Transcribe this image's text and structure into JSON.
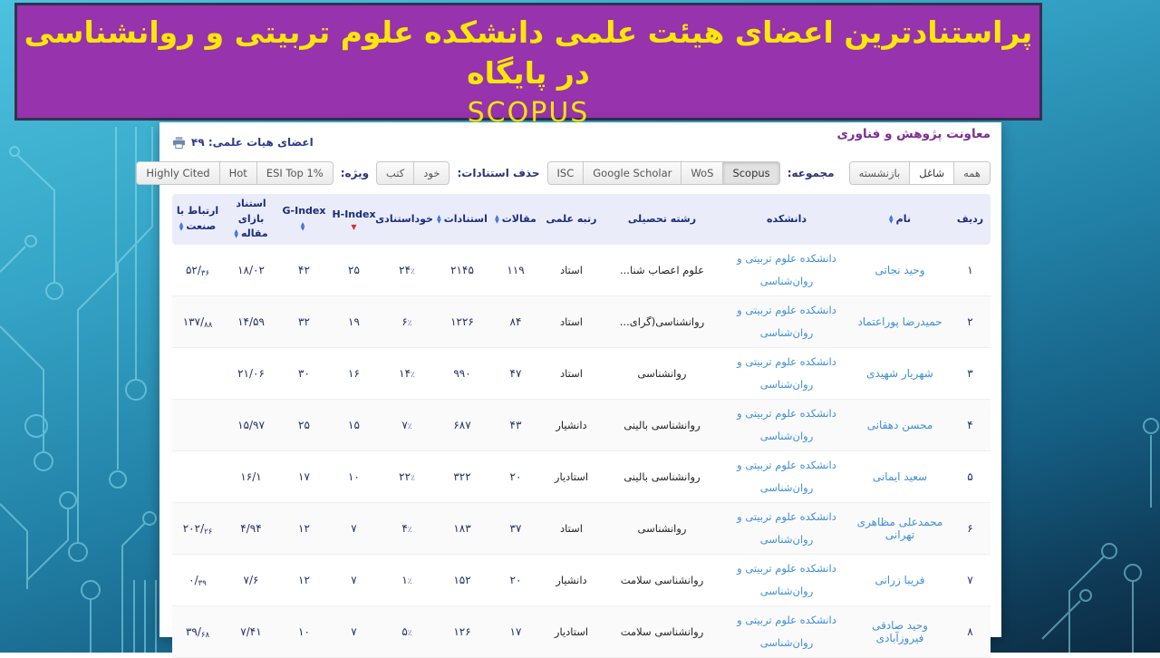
{
  "banner": {
    "title": "پراستنادترین اعضای هیئت علمی دانشکده علوم تربیتی و روانشناسی در پایگاه",
    "subtitle": "SCOPUS"
  },
  "panel": {
    "dept_header": "معاونت پژوهش و فناوری",
    "faculty_count_label": "اعضای هیات علمی: ۴۹",
    "printer_icon": "printer-icon",
    "filters": {
      "status_buttons": [
        {
          "label": "همه",
          "selected": false
        },
        {
          "label": "شاغل",
          "selected": true
        },
        {
          "label": "بازنشسته",
          "selected": false
        }
      ],
      "collection_label": "مجموعه:",
      "collection_buttons": [
        {
          "label": "Scopus",
          "selected": true
        },
        {
          "label": "WoS",
          "selected": false
        },
        {
          "label": "Google Scholar",
          "selected": false
        },
        {
          "label": "ISC",
          "selected": false
        }
      ],
      "remove_citations_label": "حذف استنادات:",
      "remove_citations_buttons": [
        {
          "label": "خود",
          "selected": false
        },
        {
          "label": "کتب",
          "selected": false
        }
      ],
      "special_label": "ویژه:",
      "special_buttons": [
        {
          "label": "ESI Top 1%",
          "selected": false
        },
        {
          "label": "Hot",
          "selected": false
        },
        {
          "label": "Highly Cited",
          "selected": false
        }
      ]
    },
    "table": {
      "columns": [
        {
          "key": "row",
          "label": "ردیف",
          "sort": "none"
        },
        {
          "key": "name",
          "label": "نام",
          "sort": "both"
        },
        {
          "key": "faculty",
          "label": "دانشکده",
          "sort": "none"
        },
        {
          "key": "field",
          "label": "رشته تحصیلی",
          "sort": "none"
        },
        {
          "key": "rank",
          "label": "رتبه علمی",
          "sort": "none"
        },
        {
          "key": "articles",
          "label": "مقالات",
          "sort": "both"
        },
        {
          "key": "citations",
          "label": "استنادات",
          "sort": "both"
        },
        {
          "key": "self_citation",
          "label": "خوداستنادی",
          "sort": "none"
        },
        {
          "key": "h_index",
          "label": "H-Index",
          "sort": "desc"
        },
        {
          "key": "g_index",
          "label": "G-Index",
          "sort": "both"
        },
        {
          "key": "cpp",
          "label": "استناد بازای مقاله",
          "sort": "both"
        },
        {
          "key": "industry",
          "label": "ارتباط با صنعت",
          "sort": "both"
        }
      ],
      "rows": [
        {
          "row": "۱",
          "name": "وحید نجاتی",
          "faculty": [
            "دانشکده علوم تربیتی و",
            "روان‌شناسی"
          ],
          "field": "علوم اعصاب شنا...",
          "rank": "استاد",
          "articles": "۱۱۹",
          "citations": "۲۱۴۵",
          "self_citation": "۲۴٪",
          "h_index": "۲۵",
          "g_index": "۴۲",
          "cpp": "۱۸/۰۲",
          "industry": "۵۲/۳۶"
        },
        {
          "row": "۲",
          "name": "حمیدرضا پوراعتماد",
          "faculty": [
            "دانشکده علوم تربیتی و",
            "روان‌شناسی"
          ],
          "field": "روانشناسی(گرای...",
          "rank": "استاد",
          "articles": "۸۴",
          "citations": "۱۲۲۶",
          "self_citation": "۶٪",
          "h_index": "۱۹",
          "g_index": "۳۲",
          "cpp": "۱۴/۵۹",
          "industry": "۱۳۷/۸۸"
        },
        {
          "row": "۳",
          "name": "شهریار شهیدی",
          "faculty": [
            "دانشکده علوم تربیتی و",
            "روان‌شناسی"
          ],
          "field": "روانشناسی",
          "rank": "استاد",
          "articles": "۴۷",
          "citations": "۹۹۰",
          "self_citation": "۱۴٪",
          "h_index": "۱۶",
          "g_index": "۳۰",
          "cpp": "۲۱/۰۶",
          "industry": ""
        },
        {
          "row": "۴",
          "name": "محسن دهقانی",
          "faculty": [
            "دانشکده علوم تربیتی و",
            "روان‌شناسی"
          ],
          "field": "روانشناسی بالینی",
          "rank": "دانشیار",
          "articles": "۴۳",
          "citations": "۶۸۷",
          "self_citation": "۷٪",
          "h_index": "۱۵",
          "g_index": "۲۵",
          "cpp": "۱۵/۹۷",
          "industry": ""
        },
        {
          "row": "۵",
          "name": "سعید ایمانی",
          "faculty": [
            "دانشکده علوم تربیتی و",
            "روان‌شناسی"
          ],
          "field": "روانشناسی بالینی",
          "rank": "استادیار",
          "articles": "۲۰",
          "citations": "۳۲۲",
          "self_citation": "۲۲٪",
          "h_index": "۱۰",
          "g_index": "۱۷",
          "cpp": "۱۶/۱",
          "industry": ""
        },
        {
          "row": "۶",
          "name": "محمدعلی مظاهری تهرانی",
          "faculty": [
            "دانشکده علوم تربیتی و",
            "روان‌شناسی"
          ],
          "field": "روانشناسی",
          "rank": "استاد",
          "articles": "۳۷",
          "citations": "۱۸۳",
          "self_citation": "۴٪",
          "h_index": "۷",
          "g_index": "۱۲",
          "cpp": "۴/۹۴",
          "industry": "۲۰۲/۲۶"
        },
        {
          "row": "۷",
          "name": "فریبا زرانی",
          "faculty": [
            "دانشکده علوم تربیتی و",
            "روان‌شناسی"
          ],
          "field": "روانشناسی سلامت",
          "rank": "دانشیار",
          "articles": "۲۰",
          "citations": "۱۵۲",
          "self_citation": "۱٪",
          "h_index": "۷",
          "g_index": "۱۲",
          "cpp": "۷/۶",
          "industry": "۰/۳۹"
        },
        {
          "row": "۸",
          "name": "وحید صادقی فیروزآبادی",
          "faculty": [
            "دانشکده علوم تربیتی و",
            "روان‌شناسی"
          ],
          "field": "روانشناسی سلامت",
          "rank": "استادیار",
          "articles": "۱۷",
          "citations": "۱۲۶",
          "self_citation": "۵٪",
          "h_index": "۷",
          "g_index": "۱۰",
          "cpp": "۷/۴۱",
          "industry": "۳۹/۶۸"
        }
      ]
    }
  },
  "colors": {
    "banner_purple": "#9633ad",
    "banner_yellow": "#ffe609",
    "link_blue": "#3f8ed6",
    "header_navy": "#1c2b7e",
    "sort_red": "#e02b2b",
    "header_bg": "#eaedf9",
    "bg_teal_top": "#4cc2de",
    "bg_navy_bottom": "#0c2a42",
    "circuit_line": "#8ee0f2"
  }
}
